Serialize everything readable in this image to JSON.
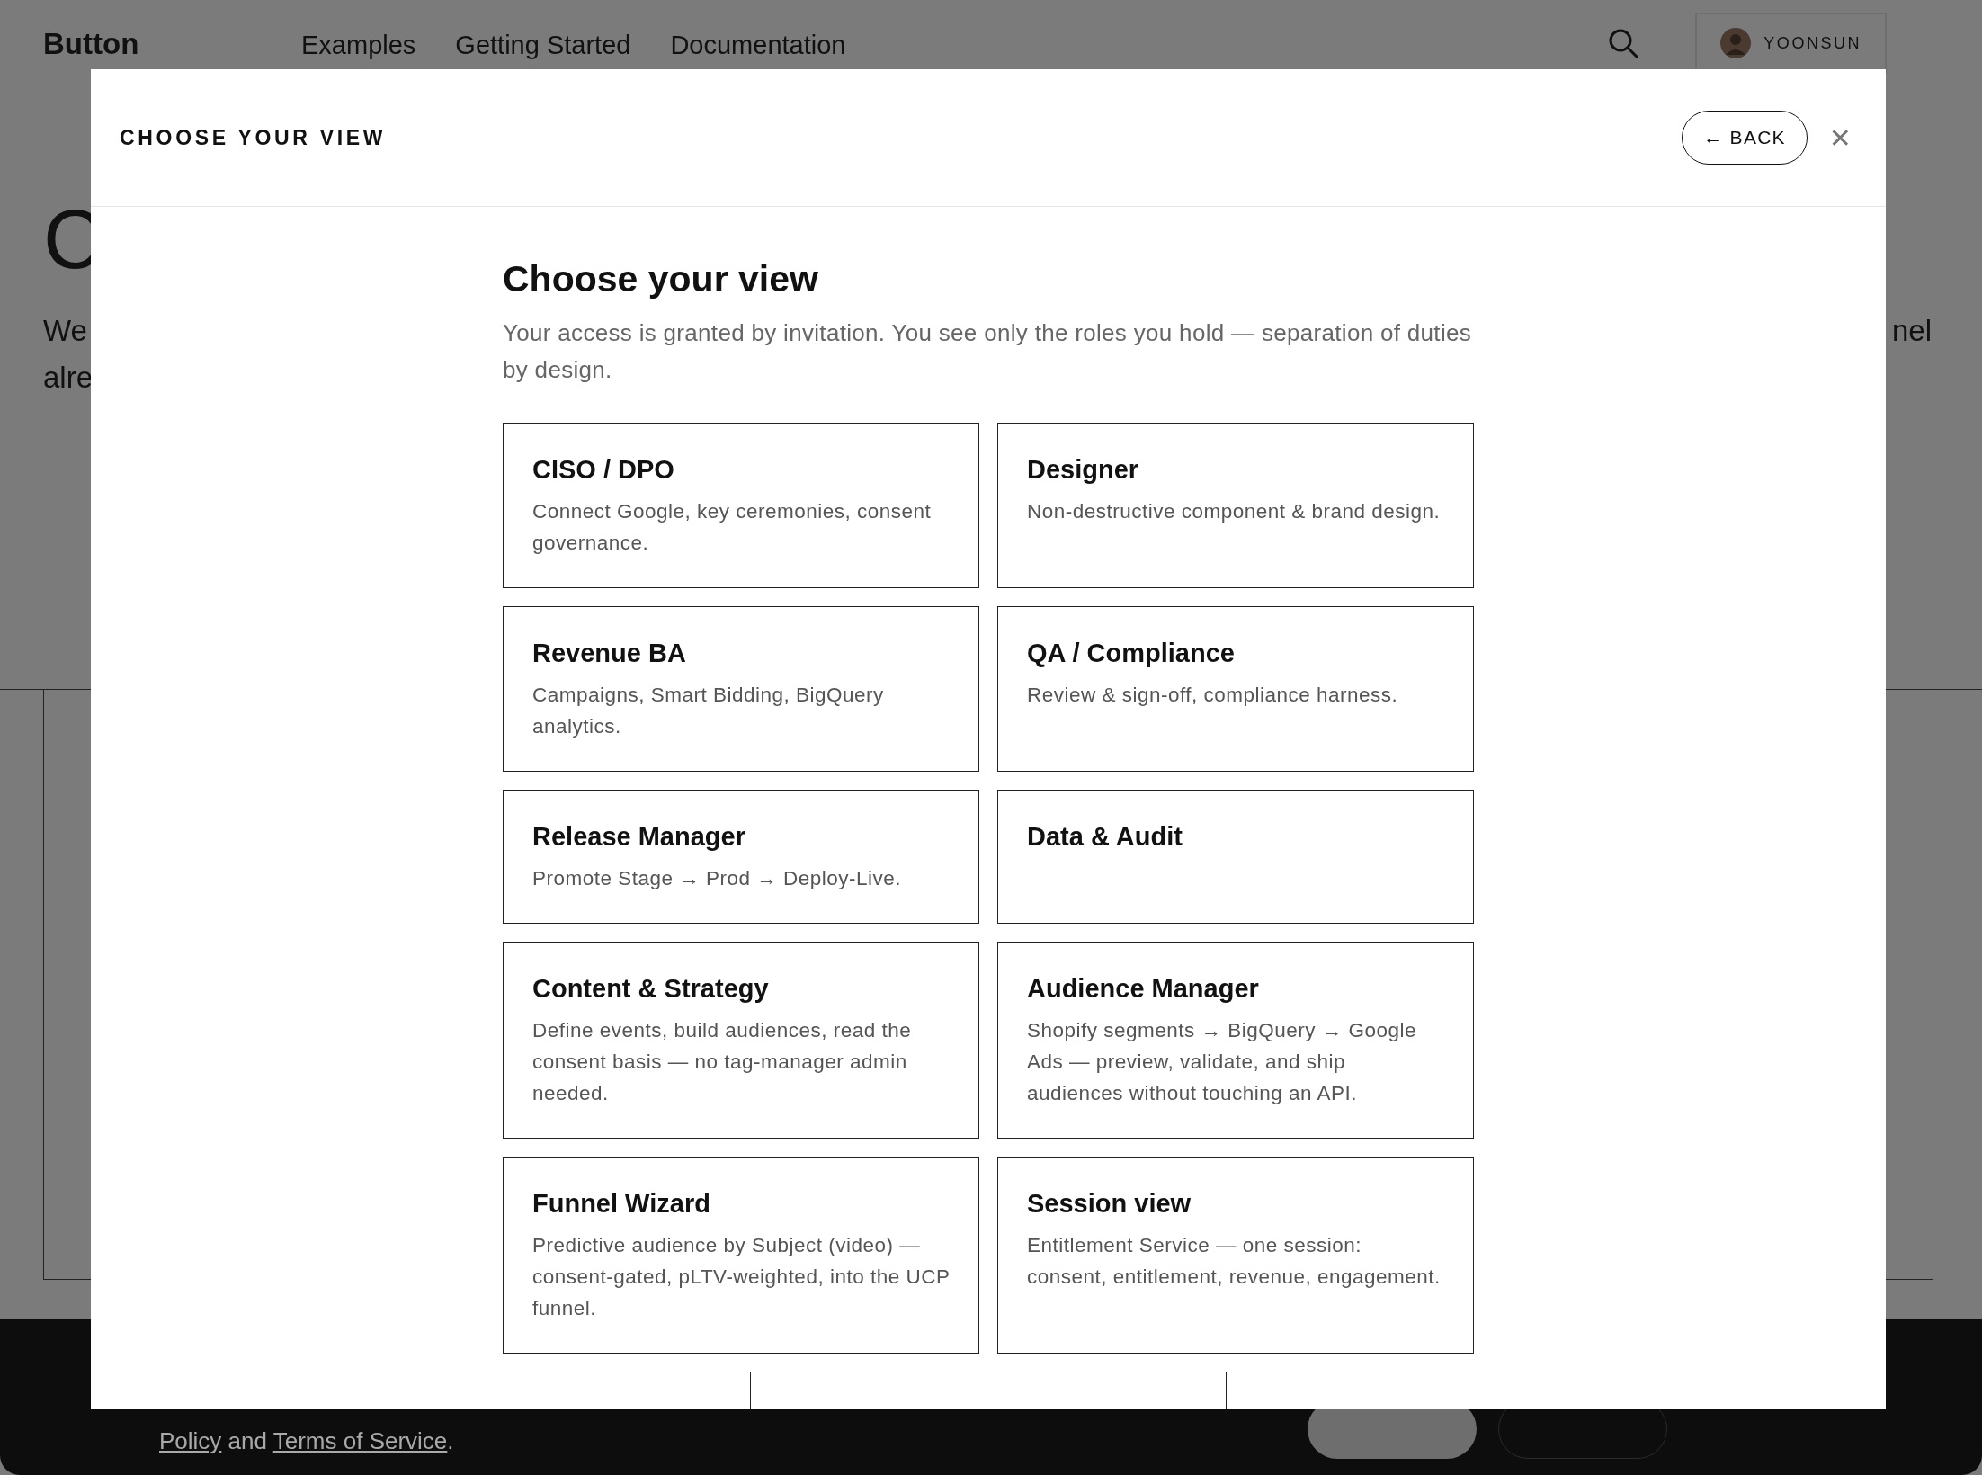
{
  "header": {
    "logo": "Button",
    "nav": [
      "Examples",
      "Getting Started",
      "Documentation"
    ],
    "user": "YOONSUN"
  },
  "background": {
    "hero_heading": "C",
    "hero_lines": [
      "We",
      "alre"
    ],
    "hero_right": "nel"
  },
  "footer": {
    "links": [
      {
        "kind": "link",
        "text": "Policy"
      },
      {
        "kind": "text",
        "text": " and "
      },
      {
        "kind": "link",
        "text": "Terms of Service"
      },
      {
        "kind": "text",
        "text": "."
      }
    ]
  },
  "modal": {
    "title": "CHOOSE YOUR VIEW",
    "back": "← BACK",
    "close": "✕",
    "heading": "Choose your view",
    "subtitle": "Your access is granted by invitation. You see only the roles you hold — separation of duties by design.",
    "roles": [
      {
        "title": "CISO / DPO",
        "description": "Connect Google, key ceremonies, consent governance."
      },
      {
        "title": "Designer",
        "description": "Non-destructive component & brand design."
      },
      {
        "title": "Revenue BA",
        "description": "Campaigns, Smart Bidding, BigQuery analytics."
      },
      {
        "title": "QA / Compliance",
        "description": "Review & sign-off, compliance harness."
      },
      {
        "title": "Release Manager",
        "description": "Promote Stage → Prod → Deploy-Live."
      },
      {
        "title": "Data & Audit"
      },
      {
        "title": "Content & Strategy",
        "description": "Define events, build audiences, read the consent basis — no tag-manager admin needed."
      },
      {
        "title": "Audience Manager",
        "description": "Shopify segments → BigQuery → Google Ads — preview, validate, and ship audiences without touching an API."
      },
      {
        "title": "Funnel Wizard",
        "description": "Predictive audience by Subject (video) — consent-gated, pLTV-weighted, into the UCP funnel."
      },
      {
        "title": "Session view",
        "description": "Entitlement Service — one session: consent, entitlement, revenue, engagement."
      }
    ],
    "extra_role": {
      "kind": "role-card"
    }
  }
}
